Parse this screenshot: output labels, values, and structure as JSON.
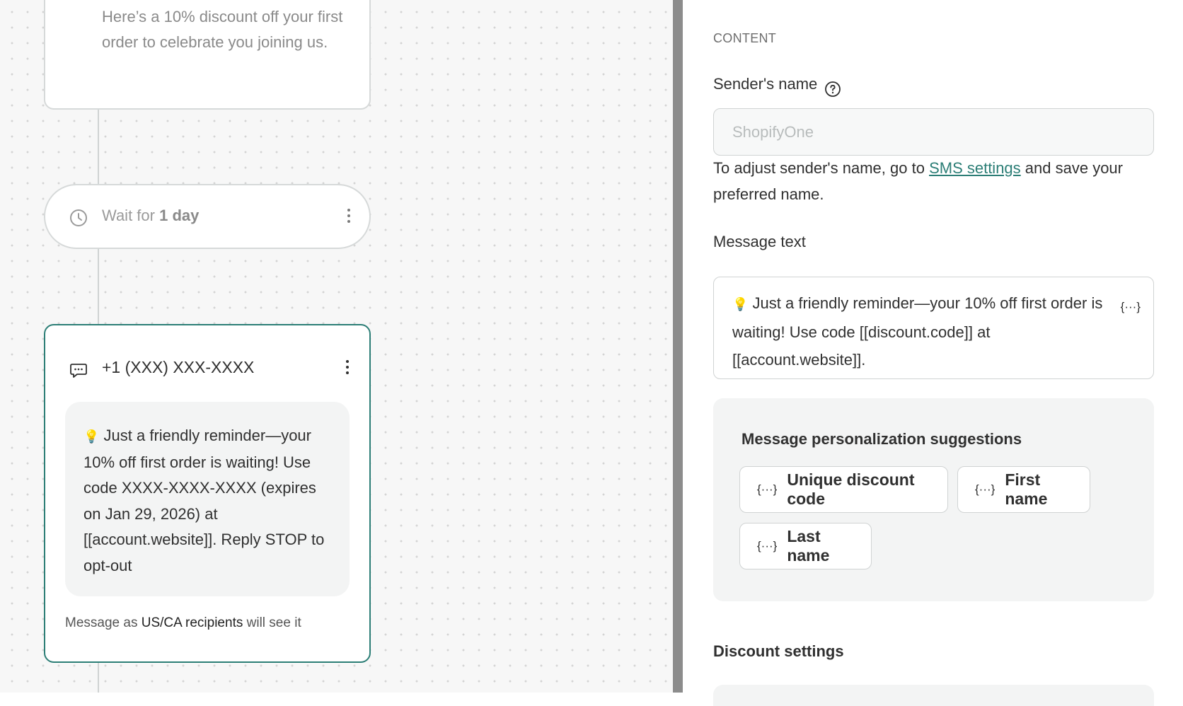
{
  "canvas": {
    "top_card_text": "Here’s a 10% discount off your first order to celebrate you joining us.",
    "wait": {
      "prefix": "Wait for",
      "duration": "1 day"
    },
    "sms": {
      "phone": "+1 (XXX) XXX-XXXX",
      "emoji": "💡",
      "body": "Just a friendly reminder—your 10% off first order is waiting! Use code XXXX-XXXX-XXXX (expires on Jan 29, 2026) at [[account.website]]. Reply STOP to opt-out",
      "note_prefix": "Message as",
      "note_bold": "US/CA recipients",
      "note_suffix": "will see it"
    }
  },
  "panel": {
    "section": "CONTENT",
    "sender_label": "Sender's name",
    "sender_placeholder": "ShopifyOne",
    "hint_prefix": "To adjust sender's name, go to",
    "hint_link": "SMS settings",
    "hint_suffix": "and save your preferred name.",
    "message_label": "Message text",
    "message_emoji": "💡",
    "message_text": "Just a friendly reminder—your 10% off first order is waiting! Use code [[discount.code]] at [[account.website]].",
    "var_button": "{···}",
    "suggestions_title": "Message personalization suggestions",
    "chips": [
      "Unique discount code",
      "First name",
      "Last name"
    ],
    "discount_title": "Discount settings"
  }
}
